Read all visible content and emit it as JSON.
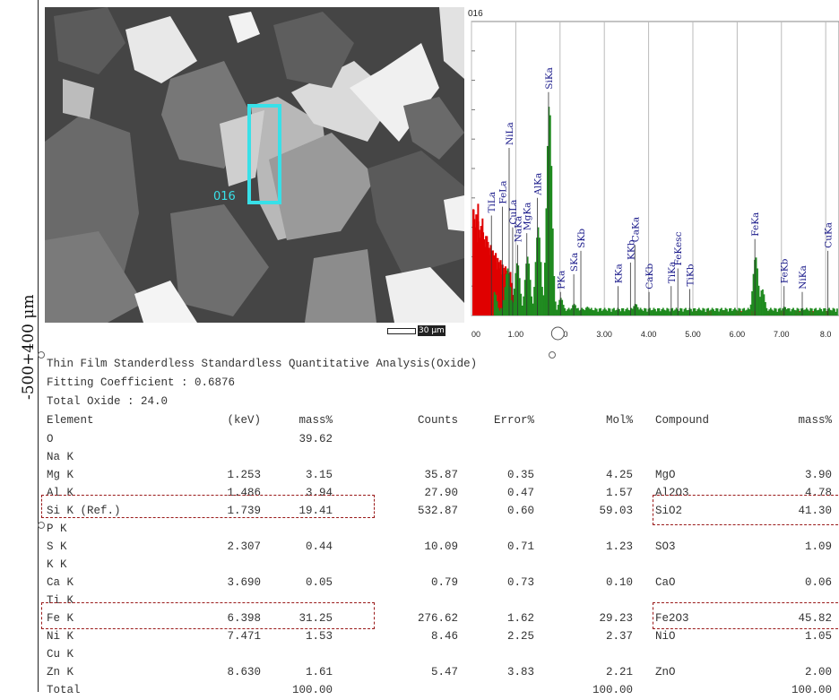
{
  "side_label": "-500+400 μm",
  "sem": {
    "roi_label": "016",
    "scale_label": "30 μm",
    "roi_color": "#38e0e8"
  },
  "chart_data": {
    "type": "bar",
    "title": "016",
    "xlabel": "",
    "ylabel": "",
    "x_ticks": [
      "00",
      "1.00",
      "2.00",
      "3.00",
      "4.00",
      "5.00",
      "6.00",
      "7.00",
      "8.0"
    ],
    "xlim": [
      0,
      8.3
    ],
    "ylim": [
      0,
      100
    ],
    "grid": true,
    "series": [
      {
        "color": "#e00000",
        "x_range": [
          0.0,
          1.05
        ],
        "x": [
          0.05,
          0.15,
          0.25,
          0.35,
          0.45,
          0.55,
          0.65,
          0.75,
          0.85,
          0.95,
          1.05
        ],
        "y": [
          36,
          38,
          33,
          27,
          22,
          18,
          14,
          12,
          9,
          7,
          4
        ]
      },
      {
        "color": "#1f8a1f",
        "x": [
          0.5,
          0.8,
          1.02,
          1.25,
          1.49,
          1.74,
          2.0,
          2.3,
          2.6,
          3.3,
          3.69,
          4.51,
          6.4,
          6.55,
          7.05,
          7.47,
          8.1
        ],
        "y": [
          8,
          16,
          18,
          20,
          30,
          72,
          6,
          4,
          3,
          2,
          4,
          2,
          20,
          9,
          3,
          2,
          1
        ]
      }
    ],
    "peaks": [
      {
        "label": "TiLa",
        "x": 0.45,
        "height": 34
      },
      {
        "label": "FeLa",
        "x": 0.7,
        "height": 37
      },
      {
        "label": "NiLa",
        "x": 0.85,
        "height": 57
      },
      {
        "label": "CuLa",
        "x": 0.93,
        "height": 30
      },
      {
        "label": "NaKa",
        "x": 1.04,
        "height": 24
      },
      {
        "label": "MgKa",
        "x": 1.25,
        "height": 28
      },
      {
        "label": "AlKa",
        "x": 1.49,
        "height": 40
      },
      {
        "label": "SiKa",
        "x": 1.74,
        "height": 76
      },
      {
        "label": "PKa",
        "x": 2.01,
        "height": 8
      },
      {
        "label": "SKa",
        "x": 2.31,
        "height": 14
      },
      {
        "label": "SKb",
        "x": 2.47,
        "height": 22
      },
      {
        "label": "KKa",
        "x": 3.31,
        "height": 10
      },
      {
        "label": "KKb",
        "x": 3.59,
        "height": 18
      },
      {
        "label": "CaKa",
        "x": 3.69,
        "height": 24
      },
      {
        "label": "CaKb",
        "x": 4.01,
        "height": 8
      },
      {
        "label": "TiKa",
        "x": 4.51,
        "height": 10
      },
      {
        "label": "FeKesc",
        "x": 4.66,
        "height": 16
      },
      {
        "label": "TiKb",
        "x": 4.93,
        "height": 9
      },
      {
        "label": "FeKa",
        "x": 6.4,
        "height": 26
      },
      {
        "label": "FeKb",
        "x": 7.06,
        "height": 10
      },
      {
        "label": "NiKa",
        "x": 7.47,
        "height": 8
      },
      {
        "label": "CuKa",
        "x": 8.05,
        "height": 22
      }
    ]
  },
  "table": {
    "line1": "Thin Film Standerdless  Standardless Quantitative Analysis(Oxide)",
    "line2": "Fitting Coefficient : 0.6876",
    "line3": "Total Oxide : 24.0",
    "headers": [
      "Element",
      "(keV)",
      "mass%",
      "Counts",
      "Error%",
      "Mol%",
      "Compound",
      "mass%"
    ],
    "rows": [
      [
        "O",
        "",
        "39.62",
        "",
        "",
        "",
        "",
        ""
      ],
      [
        "Na K",
        "",
        "",
        "",
        "",
        "",
        "",
        ""
      ],
      [
        "Mg K",
        "1.253",
        "3.15",
        "35.87",
        "0.35",
        "4.25",
        "MgO",
        "3.90"
      ],
      [
        "Al K",
        "1.486",
        "3.94",
        "27.90",
        "0.47",
        "1.57",
        "Al2O3",
        "4.78"
      ],
      [
        "Si K   (Ref.)",
        "1.739",
        "19.41",
        "532.87",
        "0.60",
        "59.03",
        "SiO2",
        "41.30"
      ],
      [
        "P K",
        "",
        "",
        "",
        "",
        "",
        "",
        ""
      ],
      [
        "S K",
        "2.307",
        "0.44",
        "10.09",
        "0.71",
        "1.23",
        "SO3",
        "1.09"
      ],
      [
        "K K",
        "",
        "",
        "",
        "",
        "",
        "",
        ""
      ],
      [
        "Ca K",
        "3.690",
        "0.05",
        "0.79",
        "0.73",
        "0.10",
        "CaO",
        "0.06"
      ],
      [
        "Ti K",
        "",
        "",
        "",
        "",
        "",
        "",
        ""
      ],
      [
        "Fe K",
        "6.398",
        "31.25",
        "276.62",
        "1.62",
        "29.23",
        "Fe2O3",
        "45.82"
      ],
      [
        "Ni K",
        "7.471",
        "1.53",
        "8.46",
        "2.25",
        "2.37",
        "NiO",
        "1.05"
      ],
      [
        "Cu K",
        "",
        "",
        "",
        "",
        "",
        "",
        ""
      ],
      [
        "Zn K",
        "8.630",
        "1.61",
        "5.47",
        "3.83",
        "2.21",
        "ZnO",
        "2.00"
      ],
      [
        "Total",
        "",
        "100.00",
        "",
        "",
        "100.00",
        "",
        "100.00"
      ]
    ]
  }
}
